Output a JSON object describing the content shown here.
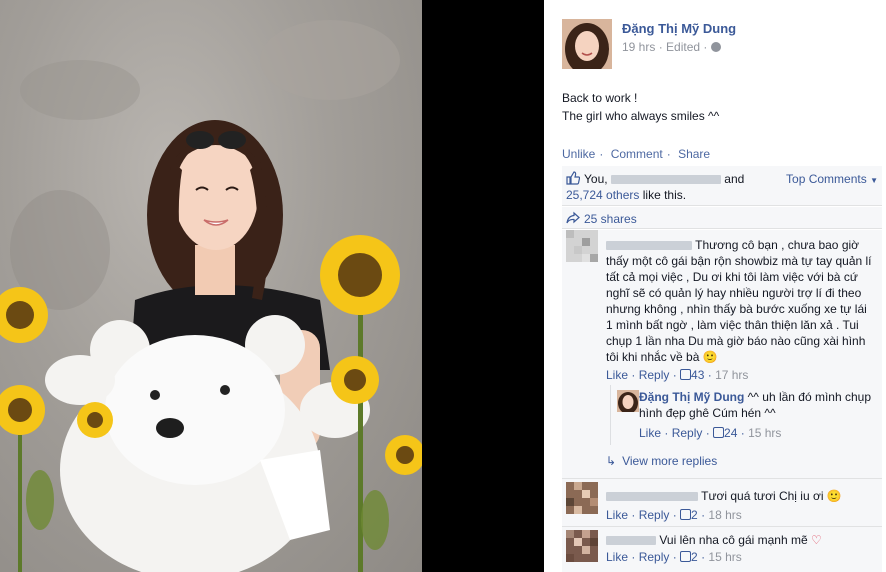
{
  "author": {
    "name": "Đặng Thị Mỹ Dung",
    "time": "19 hrs",
    "edited": "Edited"
  },
  "post": {
    "line1": "Back to work !",
    "line2": "The girl who always smiles ^^"
  },
  "actions": {
    "unlike": "Unlike",
    "comment": "Comment",
    "share": "Share",
    "sep": "·"
  },
  "likes": {
    "you": "You,",
    "and": "and",
    "others": "25,724 others",
    "like_this": "like this.",
    "top_comments": "Top Comments"
  },
  "shares": {
    "label": "25 shares"
  },
  "comments": [
    {
      "text": "Thương cô bạn , chưa bao giờ thấy một cô gái bận rộn showbiz mà tự tay quản lí tất cả mọi việc , Du ơi khi tôi làm việc với bà cứ nghĩ sẽ có quản lý hay nhiều người trợ lí đi theo nhưng không , nhìn thấy bà bước xuống xe tự lái 1 mình bất ngờ , làm việc thân thiện lăn xả . Tui chụp 1 lần nha Du mà giờ báo nào cũng xài hình tôi khi nhắc về bà",
      "emoji": "🙂",
      "like": "Like",
      "reply": "Reply",
      "likes": "43",
      "time": "17 hrs"
    },
    {
      "author": "Đặng Thị Mỹ Dung",
      "text": "^^ uh lần đó mình chụp hình đẹp ghê Cúm hén ^^",
      "like": "Like",
      "reply": "Reply",
      "likes": "24",
      "time": "15 hrs"
    },
    {
      "text": "Tươi quá tươi Chị iu ơi",
      "emoji": "🙂",
      "like": "Like",
      "reply": "Reply",
      "likes": "2",
      "time": "18 hrs"
    },
    {
      "text": "Vui lên nha cô gái mạnh mẽ",
      "emoji": "♡",
      "like": "Like",
      "reply": "Reply",
      "likes": "2",
      "time": "15 hrs"
    }
  ],
  "view_more": "View more replies",
  "colors": {
    "link": "#3b5998",
    "muted": "#90949c",
    "bg_comments": "#f6f7f9"
  }
}
